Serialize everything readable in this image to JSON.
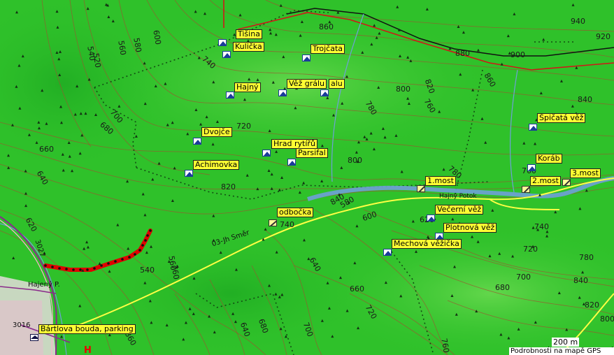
{
  "map": {
    "colors": {
      "forest": "#2fc12a",
      "meadow": "#5fd24a",
      "track": "#ff3030",
      "boundary": "#1a5f1a",
      "stream": "#6fa0d8",
      "road": "#ffff33"
    },
    "pois": [
      {
        "label": "Tišina",
        "type": "peak"
      },
      {
        "label": "Kulička",
        "type": "peak"
      },
      {
        "label": "Trojčata",
        "type": "peak"
      },
      {
        "label": "Hajný",
        "type": "peak"
      },
      {
        "label": "Věž grálu",
        "type": "peak"
      },
      {
        "label": "alu",
        "type": "peak"
      },
      {
        "label": "Dvojče",
        "type": "peak"
      },
      {
        "label": "Hrad rytířů",
        "type": "peak"
      },
      {
        "label": "Parsifal",
        "type": "peak"
      },
      {
        "label": "Achimovka",
        "type": "peak"
      },
      {
        "label": "Špičatá věž",
        "type": "peak"
      },
      {
        "label": "Koráb",
        "type": "peak"
      },
      {
        "label": "3.most",
        "type": "bridge"
      },
      {
        "label": "2.most",
        "type": "bridge"
      },
      {
        "label": "1.most",
        "type": "bridge"
      },
      {
        "label": "Večerní věž",
        "type": "peak"
      },
      {
        "label": "Plotnová věž",
        "type": "peak"
      },
      {
        "label": "Mechová věžička",
        "type": "peak"
      },
      {
        "label": "odbočka",
        "type": "junction"
      },
      {
        "label": "Bártlova bouda, parking",
        "type": "parking"
      }
    ],
    "contours": [
      "940",
      "920",
      "880",
      "900",
      "860",
      "860",
      "840",
      "820",
      "800",
      "780",
      "760",
      "740",
      "720",
      "700",
      "680",
      "660",
      "640",
      "620",
      "600",
      "580",
      "560",
      "540",
      "520",
      "800",
      "820",
      "840",
      "780",
      "760",
      "740",
      "720",
      "700",
      "680",
      "660",
      "640",
      "620",
      "600",
      "580",
      "560",
      "540",
      "860",
      "840",
      "820",
      "800",
      "780",
      "760",
      "740",
      "720",
      "700",
      "680",
      "640",
      "760",
      "780"
    ],
    "roads": {
      "trail": "03-Jh Směr",
      "creek": "Hajný Potok",
      "route": "3027",
      "route2": "3016",
      "place": "Hajený P."
    },
    "scale": "200 m",
    "attribution": "Podrobnosti na mapě GPS"
  }
}
